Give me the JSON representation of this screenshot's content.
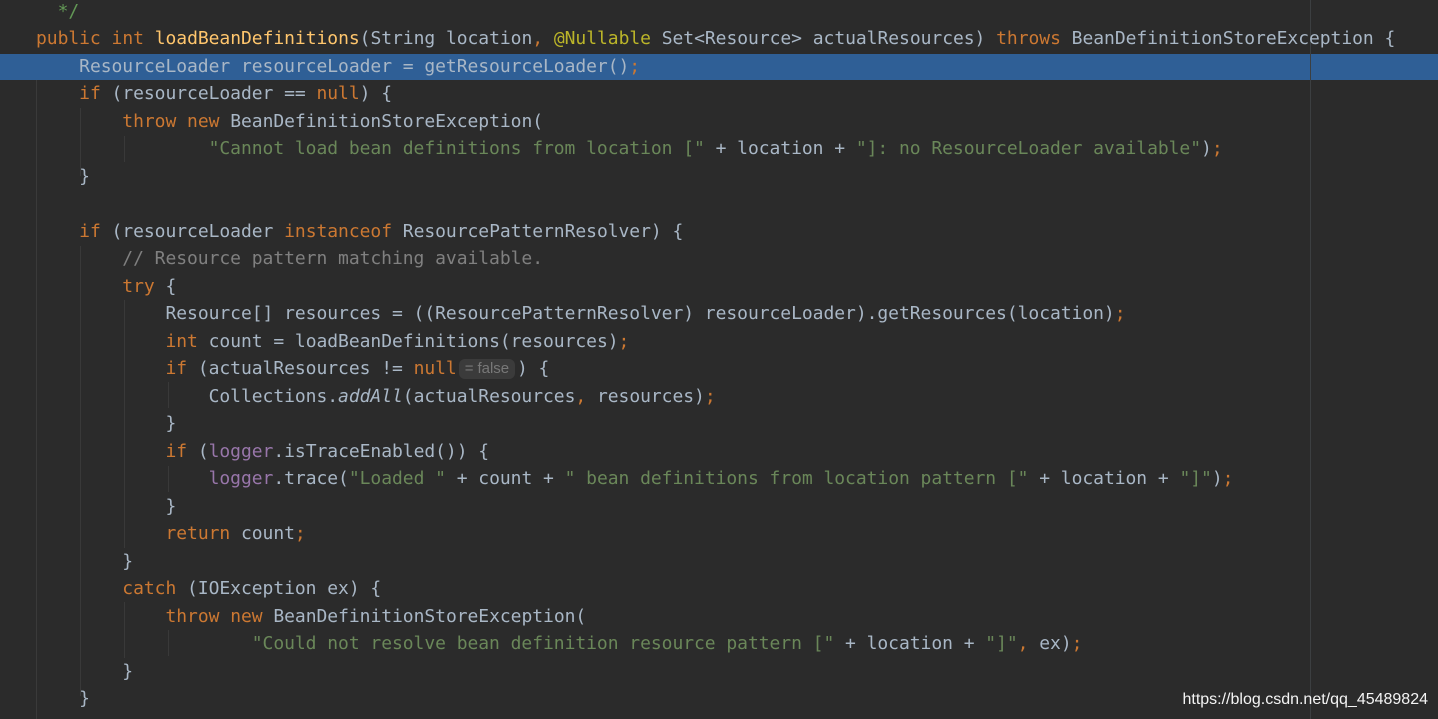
{
  "colors": {
    "background": "#2b2b2b",
    "keyword": "#cc7832",
    "method_decl": "#ffc66d",
    "string": "#6a8759",
    "comment": "#808080",
    "annotation": "#bbb529",
    "field": "#9876aa",
    "default_text": "#a9b7c6",
    "selected_line": "#2f5f96"
  },
  "code": {
    "l01_doc_end": "*/",
    "l02_public": "public",
    "l02_int": "int",
    "l02_method": "loadBeanDefinitions",
    "l02_params_a": "(String location",
    "l02_comma": ",",
    "l02_annotation": "@Nullable",
    "l02_params_b": "Set<Resource> actualResources)",
    "l02_throws": "throws",
    "l02_tail": "BeanDefinitionStoreException {",
    "l03_body": "ResourceLoader resourceLoader = getResourceLoader()",
    "l03_semi": ";",
    "l04_if": "if",
    "l04_cond": "(resourceLoader == ",
    "l04_null": "null",
    "l04_tail": ") {",
    "l05_throw": "throw",
    "l05_new": "new",
    "l05_tail": "BeanDefinitionStoreException(",
    "l06_str1": "\"Cannot load bean definitions from location [\"",
    "l06_plus1": " + location + ",
    "l06_str2": "\"]: no ResourceLoader available\"",
    "l06_tail": ")",
    "l06_semi": ";",
    "l07_brace": "}",
    "l09_if": "if",
    "l09_cond_a": "(resourceLoader ",
    "l09_instanceof": "instanceof",
    "l09_cond_b": " ResourcePatternResolver) {",
    "l10_comment": "// Resource pattern matching available.",
    "l11_try": "try",
    "l11_tail": " {",
    "l12_body": "Resource[] resources = ((ResourcePatternResolver) resourceLoader).getResources(location)",
    "l12_semi": ";",
    "l13_int": "int",
    "l13_body": " count = loadBeanDefinitions(resources)",
    "l13_semi": ";",
    "l14_if": "if",
    "l14_cond": " (actualResources != ",
    "l14_null": "null",
    "l14_hint": "= false",
    "l14_tail": ") {",
    "l15_a": "Collections.",
    "l15_method": "addAll",
    "l15_b": "(actualResources",
    "l15_comma": ",",
    "l15_c": " resources)",
    "l15_semi": ";",
    "l16_brace": "}",
    "l17_if": "if",
    "l17_a": " (",
    "l17_logger": "logger",
    "l17_b": ".isTraceEnabled()) {",
    "l18_logger": "logger",
    "l18_a": ".trace(",
    "l18_str1": "\"Loaded \"",
    "l18_b": " + count + ",
    "l18_str2": "\" bean definitions from location pattern [\"",
    "l18_c": " + location + ",
    "l18_str3": "\"]\"",
    "l18_d": ")",
    "l18_semi": ";",
    "l19_brace": "}",
    "l20_return": "return",
    "l20_body": " count",
    "l20_semi": ";",
    "l21_brace": "}",
    "l22_catch": "catch",
    "l22_body": " (IOException ex) {",
    "l23_throw": "throw",
    "l23_new": "new",
    "l23_tail": "BeanDefinitionStoreException(",
    "l24_str1": "\"Could not resolve bean definition resource pattern [\"",
    "l24_a": " + location + ",
    "l24_str2": "\"]\"",
    "l24_comma": ",",
    "l24_b": " ex)",
    "l24_semi": ";",
    "l25_brace": "}",
    "l26_brace": "}"
  },
  "watermark": "https://blog.csdn.net/qq_45489824"
}
